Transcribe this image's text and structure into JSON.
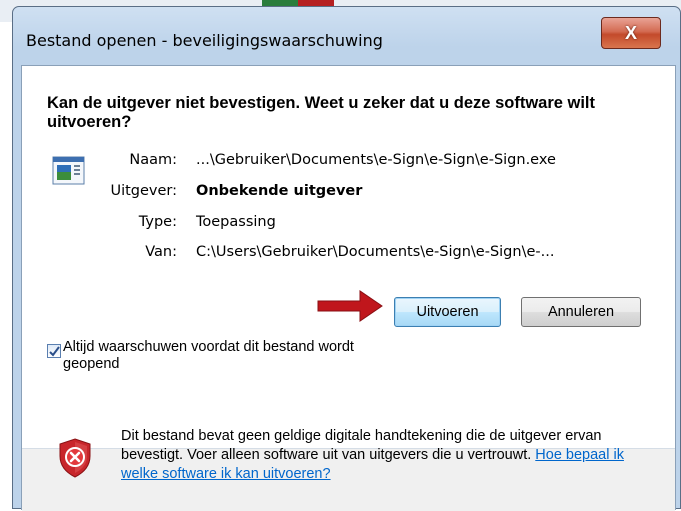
{
  "window": {
    "title": "Bestand openen - beveiligingswaarschuwing",
    "close_label": "X"
  },
  "prompt": {
    "heading": "Kan de uitgever niet bevestigen. Weet u zeker dat u deze software wilt uitvoeren?"
  },
  "details": [
    {
      "label": "Naam:",
      "value": "...\\Gebruiker\\Documents\\e-Sign\\e-Sign\\e-Sign.exe",
      "bold": false
    },
    {
      "label": "Uitgever:",
      "value": "Onbekende uitgever",
      "bold": true
    },
    {
      "label": "Type:",
      "value": "Toepassing",
      "bold": false
    },
    {
      "label": "Van:",
      "value": "C:\\Users\\Gebruiker\\Documents\\e-Sign\\e-Sign\\e-...",
      "bold": false
    }
  ],
  "buttons": {
    "run": "Uitvoeren",
    "cancel": "Annuleren"
  },
  "checkbox": {
    "checked": true,
    "label": "Altijd waarschuwen voordat dit bestand wordt geopend"
  },
  "warning": {
    "text": "Dit bestand bevat geen geldige digitale handtekening die de uitgever ervan bevestigt. Voer alleen software uit van uitgevers die u vertrouwt.",
    "link": "Hoe bepaal ik welke software ik kan uitvoeren?"
  },
  "colors": {
    "arrow": "#c0161c",
    "link": "#0066cc",
    "shield": "#c8262b"
  },
  "icons": [
    "application-icon",
    "close-icon",
    "red-arrow-icon",
    "checkmark-icon",
    "shield-warning-icon"
  ]
}
